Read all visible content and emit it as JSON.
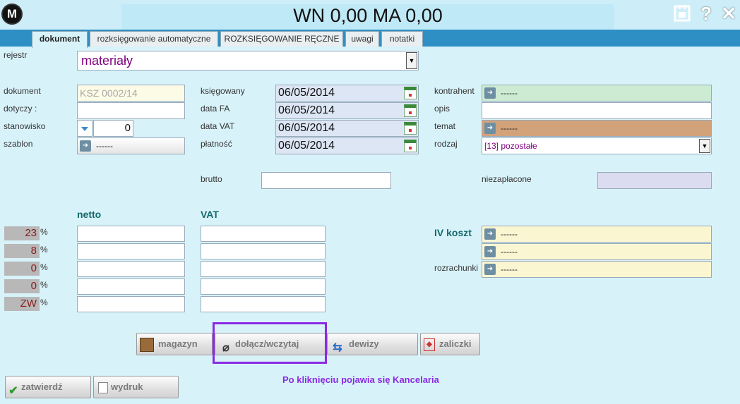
{
  "header": {
    "title": "WN 0,00 MA 0,00",
    "logo_text": "M",
    "icons": [
      "calendar-grid-icon",
      "help-icon",
      "close-icon"
    ],
    "help_glyph": "?",
    "close_glyph": "✕"
  },
  "tabs": [
    {
      "label": "dokument",
      "active": true
    },
    {
      "label": "rozksięgowanie automatyczne",
      "active": false
    },
    {
      "label": "ROZKSIĘGOWANIE RĘCZNE",
      "active": false
    },
    {
      "label": "uwagi",
      "active": false
    },
    {
      "label": "notatki",
      "active": false
    }
  ],
  "form": {
    "rejestr_label": "rejestr",
    "rejestr_value": "materiały",
    "dokument_label": "dokument",
    "dokument_value": "KSZ 0002/14",
    "dotyczy_label": "dotyczy :",
    "dotyczy_value": "",
    "stanowisko_label": "stanowisko",
    "stanowisko_value": "0",
    "szablon_label": "szablon",
    "szablon_value": "------",
    "ksiegowany_label": "księgowany",
    "ksiegowany_value": "06/05/2014",
    "data_fa_label": "data FA",
    "data_fa_value": "06/05/2014",
    "data_vat_label": "data VAT",
    "data_vat_value": "06/05/2014",
    "platnosc_label": "płatność",
    "platnosc_value": "06/05/2014",
    "kontrahent_label": "kontrahent",
    "kontrahent_value": "------",
    "opis_label": "opis",
    "opis_value": "",
    "temat_label": "temat",
    "temat_value": "------",
    "rodzaj_label": "rodzaj",
    "rodzaj_value": "[13] pozostałe",
    "brutto_label": "brutto",
    "brutto_value": "",
    "niezaplacone_label": "niezapłacone",
    "niezaplacone_value": ""
  },
  "vat_table": {
    "netto_header": "netto",
    "vat_header": "VAT",
    "percent_sign": "%",
    "rates": [
      "23",
      "8",
      "0",
      "0",
      "ZW"
    ]
  },
  "right_panel": {
    "iv_koszt_label": "IV koszt",
    "iv_koszt_1": "------",
    "iv_koszt_2": "------",
    "rozrachunki_label": "rozrachunki",
    "rozrachunki_value": "------"
  },
  "buttons": {
    "magazyn": "magazyn",
    "dolacz": "dołącz/wczytaj",
    "dewizy": "dewizy",
    "zaliczki": "zaliczki",
    "zatwierdz": "zatwierdź",
    "wydruk": "wydruk"
  },
  "annotation": "Po kliknięciu pojawia się Kancelaria",
  "colors": {
    "background": "#d8f2fa",
    "tabbar": "#2e8fc4",
    "highlight_box": "#8a2be2",
    "annotation": "#8a2be2",
    "rejestr_text": "#800080"
  }
}
